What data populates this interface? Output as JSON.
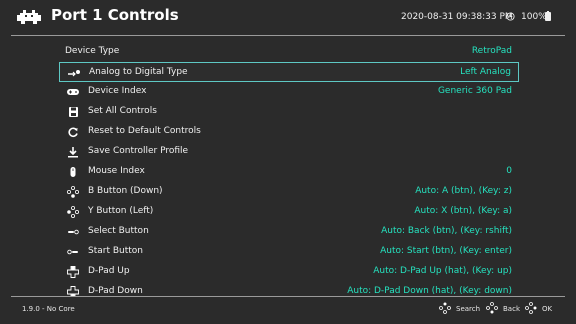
{
  "header": {
    "title": "Port 1 Controls",
    "datetime": "2020-08-31 09:38:33 PM",
    "battery": "100%"
  },
  "menu": {
    "items": [
      {
        "label": "Device Type",
        "value": "RetroPad",
        "icon": "none"
      },
      {
        "label": "Analog to Digital Type",
        "value": "Left Analog",
        "icon": "analog-stick-icon",
        "selected": true
      },
      {
        "label": "Device Index",
        "value": "Generic 360 Pad",
        "icon": "gamepad-icon"
      },
      {
        "label": "Set All Controls",
        "value": "",
        "icon": "save-icon"
      },
      {
        "label": "Reset to Default Controls",
        "value": "",
        "icon": "reset-icon"
      },
      {
        "label": "Save Controller Profile",
        "value": "",
        "icon": "download-icon"
      },
      {
        "label": "Mouse Index",
        "value": "0",
        "icon": "mouse-icon"
      },
      {
        "label": "B Button (Down)",
        "value": "Auto:  A (btn), (Key: z)",
        "icon": "face-buttons-down-icon"
      },
      {
        "label": "Y Button (Left)",
        "value": "Auto:  X (btn), (Key: a)",
        "icon": "face-buttons-left-icon"
      },
      {
        "label": "Select Button",
        "value": "Auto:  Back (btn), (Key: rshift)",
        "icon": "select-button-icon"
      },
      {
        "label": "Start Button",
        "value": "Auto:  Start (btn), (Key: enter)",
        "icon": "start-button-icon"
      },
      {
        "label": "D-Pad Up",
        "value": "Auto:  D-Pad Up (hat), (Key: up)",
        "icon": "dpad-up-icon"
      },
      {
        "label": "D-Pad Down",
        "value": "Auto:  D-Pad Down (hat), (Key: down)",
        "icon": "dpad-down-icon"
      }
    ]
  },
  "footer": {
    "version": "1.9.0 - No Core",
    "hints": [
      {
        "label": "Search",
        "icon": "face-buttons-search-icon"
      },
      {
        "label": "Back",
        "icon": "face-buttons-back-icon"
      },
      {
        "label": "OK",
        "icon": "face-buttons-ok-icon"
      }
    ]
  },
  "colors": {
    "background": "#2b2b2b",
    "accent": "#26e2bf",
    "selection_border": "#5ec8c4",
    "divider": "#9a9a9a"
  }
}
